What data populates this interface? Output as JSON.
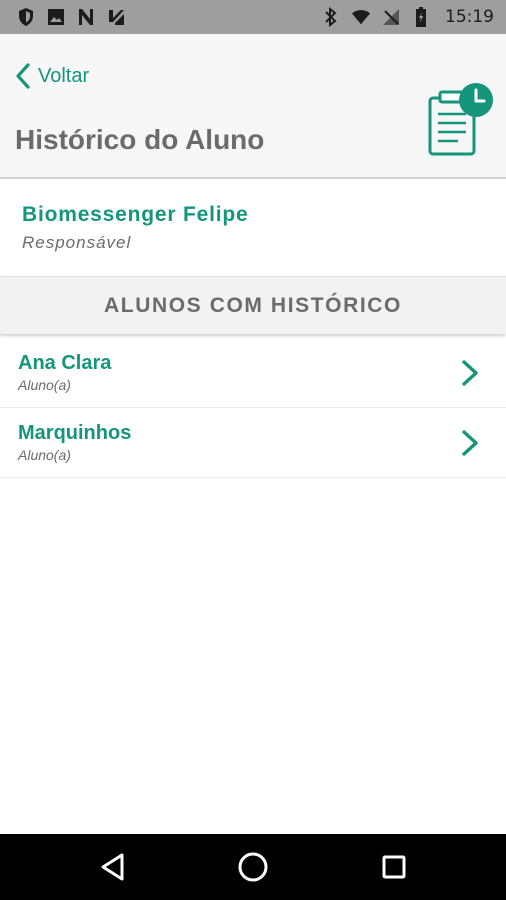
{
  "status_bar": {
    "time": "15:19",
    "left_icons": [
      "shield-icon",
      "image-icon",
      "n-icon",
      "check-app-icon"
    ],
    "right_icons": [
      "bluetooth-icon",
      "wifi-icon",
      "signal-icon",
      "battery-icon"
    ]
  },
  "header": {
    "back_label": "Voltar",
    "title": "Histórico do Aluno",
    "icon": "history-document-icon"
  },
  "responsible": {
    "name": "Biomessenger Felipe",
    "role": "Responsável"
  },
  "section": {
    "title": "ALUNOS COM HISTÓRICO"
  },
  "students": [
    {
      "name": "Ana Clara",
      "role": "Aluno(a)"
    },
    {
      "name": "Marquinhos",
      "role": "Aluno(a)"
    }
  ],
  "nav_bar": {
    "icons": [
      "back-triangle-icon",
      "home-circle-icon",
      "recent-square-icon"
    ]
  },
  "colors": {
    "accent": "#15967c",
    "title_gray": "#6b6b6b",
    "status_bar": "#9e9e9e",
    "nav_bar": "#000000"
  }
}
